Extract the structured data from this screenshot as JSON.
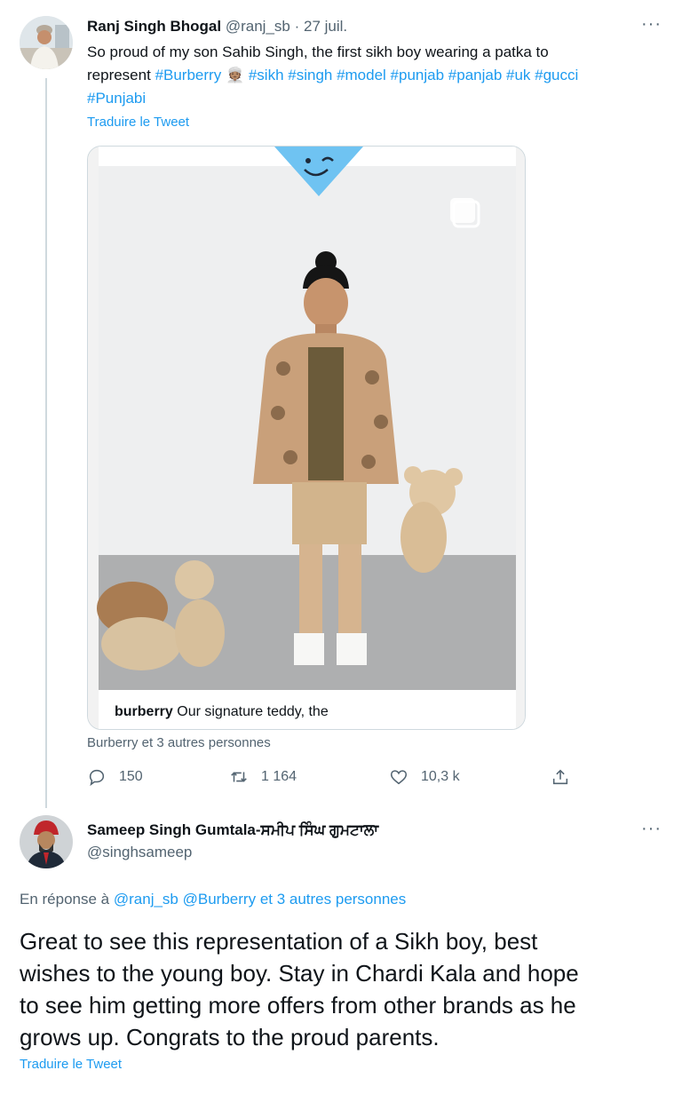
{
  "tweet1": {
    "author_name": "Ranj Singh Bhogal",
    "handle": "@ranj_sb",
    "separator": "·",
    "date": "27 juil.",
    "more": "···",
    "text_line1": "So proud of my son Sahib Singh, the first sikh boy wearing a patka to",
    "text_line2_prefix": "represent",
    "hashtags_line2_a": "#Burberry",
    "emoji": "👳🏽",
    "hashtags_line2_b": "#sikh #singh #model #punjab #panjab #uk #gucci",
    "hashtags_line3": "#Punjabi",
    "translate": "Traduire le Tweet",
    "media_caption_user": "burberry",
    "media_caption_text": "Our signature teddy, the",
    "tagged": "Burberry et 3 autres personnes",
    "replies": "150",
    "retweets": "1 164",
    "likes": "10,3 k"
  },
  "tweet2": {
    "author_name": "Sameep Singh Gumtala-ਸਮੀਪ ਸਿੰਘ ਗੁਮਟਾਲਾ",
    "handle": "@singhsameep",
    "more": "···",
    "reply_prefix": "En réponse à",
    "reply_to_1": "@ranj_sb",
    "reply_to_2": "@Burberry",
    "reply_to_3": "et 3 autres personnes",
    "text_line1": "Great to see this representation of a Sikh boy, best",
    "text_line2": "wishes to the young boy. Stay in Chardi Kala and hope",
    "text_line3": "to see him getting more offers from other brands as he",
    "text_line4": "grows up. Congrats to the proud parents.",
    "translate": "Traduire le Tweet"
  },
  "colors": {
    "link": "#1d9bf0",
    "muted": "#536471",
    "text": "#0f1419"
  },
  "icons": [
    "more-icon",
    "reply-icon",
    "retweet-icon",
    "like-icon",
    "share-icon",
    "multi-image-icon"
  ]
}
